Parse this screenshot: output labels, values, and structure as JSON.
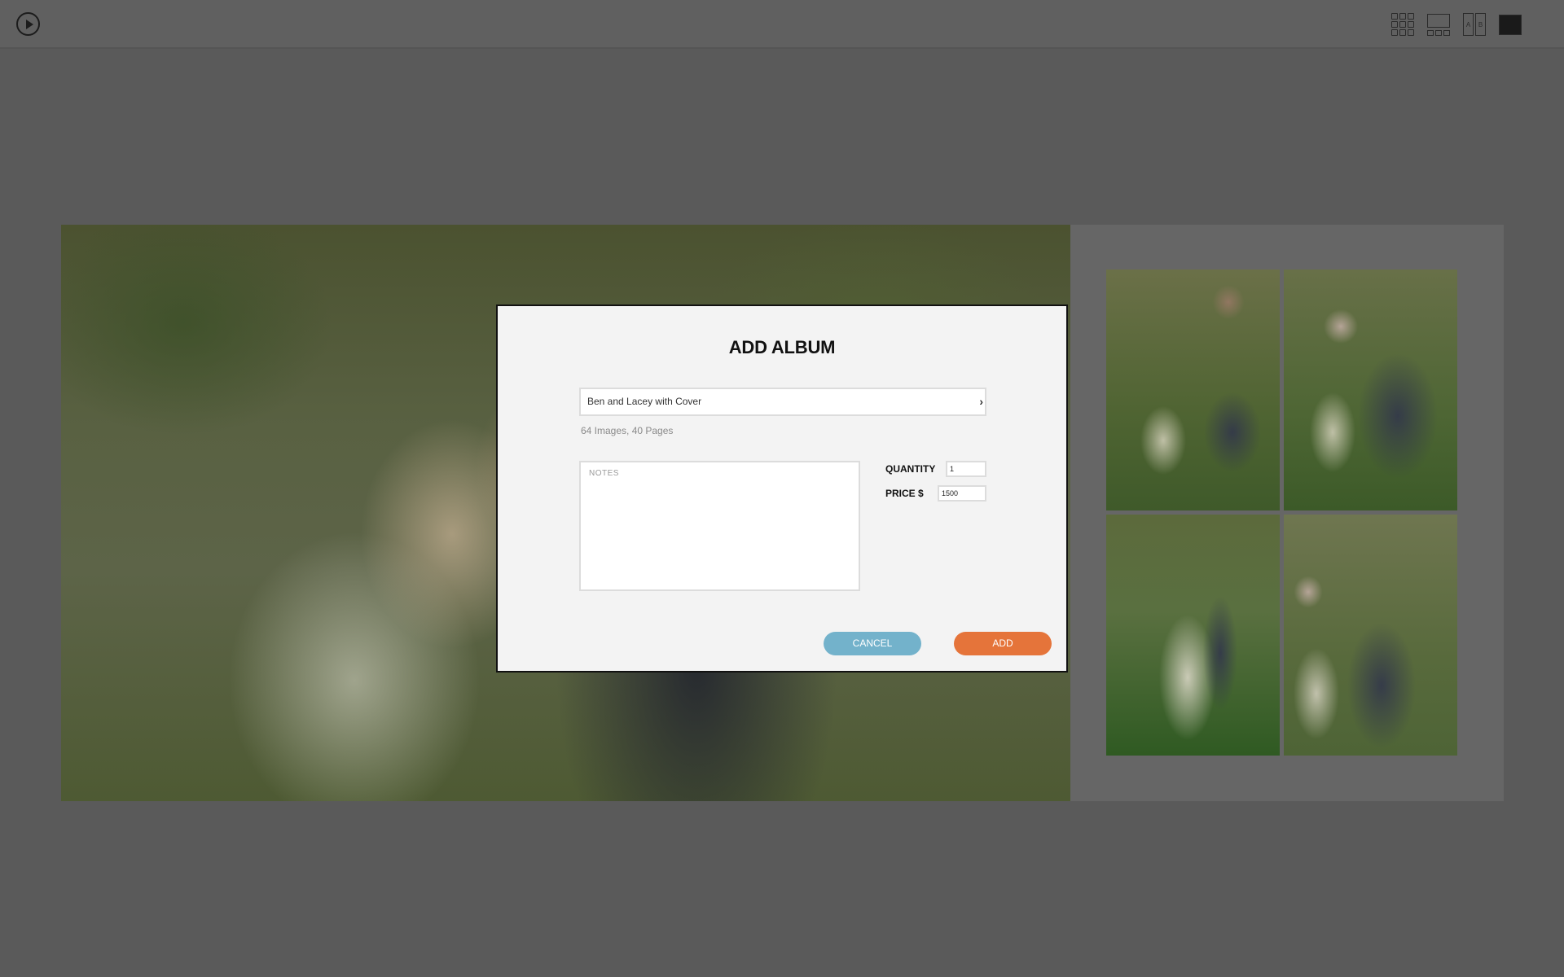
{
  "toolbar": {
    "play": {
      "icon": "play-circle-icon",
      "label": "Play slideshow"
    },
    "view_options": [
      {
        "icon": "grid-9-icon",
        "label": "Grid view"
      },
      {
        "icon": "single-plus-filmstrip-icon",
        "label": "Single view"
      },
      {
        "icon": "compare-ab-icon",
        "label": "Compare view",
        "a": "A",
        "b": "B"
      },
      {
        "icon": "solid-square-icon",
        "label": "Full view"
      }
    ]
  },
  "spread": {
    "left_page": {
      "description": "Wedding couple close-up photo"
    },
    "right_page": {
      "thumbnails": [
        {
          "description": "Groom kissing bride's forehead"
        },
        {
          "description": "Couple embracing, bride looking at camera"
        },
        {
          "description": "Couple standing full-length, bride holding bouquet"
        },
        {
          "description": "Couple embracing under willow tree"
        }
      ]
    }
  },
  "modal": {
    "title": "ADD ALBUM",
    "album_select": {
      "value": "Ben and Lacey with Cover",
      "icon": "chevron-right-icon",
      "chevron": "›"
    },
    "album_meta": "64 Images, 40 Pages",
    "notes": {
      "placeholder": "NOTES",
      "value": ""
    },
    "quantity": {
      "label": "QUANTITY",
      "value": "1"
    },
    "price": {
      "label": "PRICE $",
      "value": "1500"
    },
    "cancel_label": "CANCEL",
    "add_label": "ADD",
    "colors": {
      "cancel": "#73b2cb",
      "add": "#e5743a"
    }
  }
}
